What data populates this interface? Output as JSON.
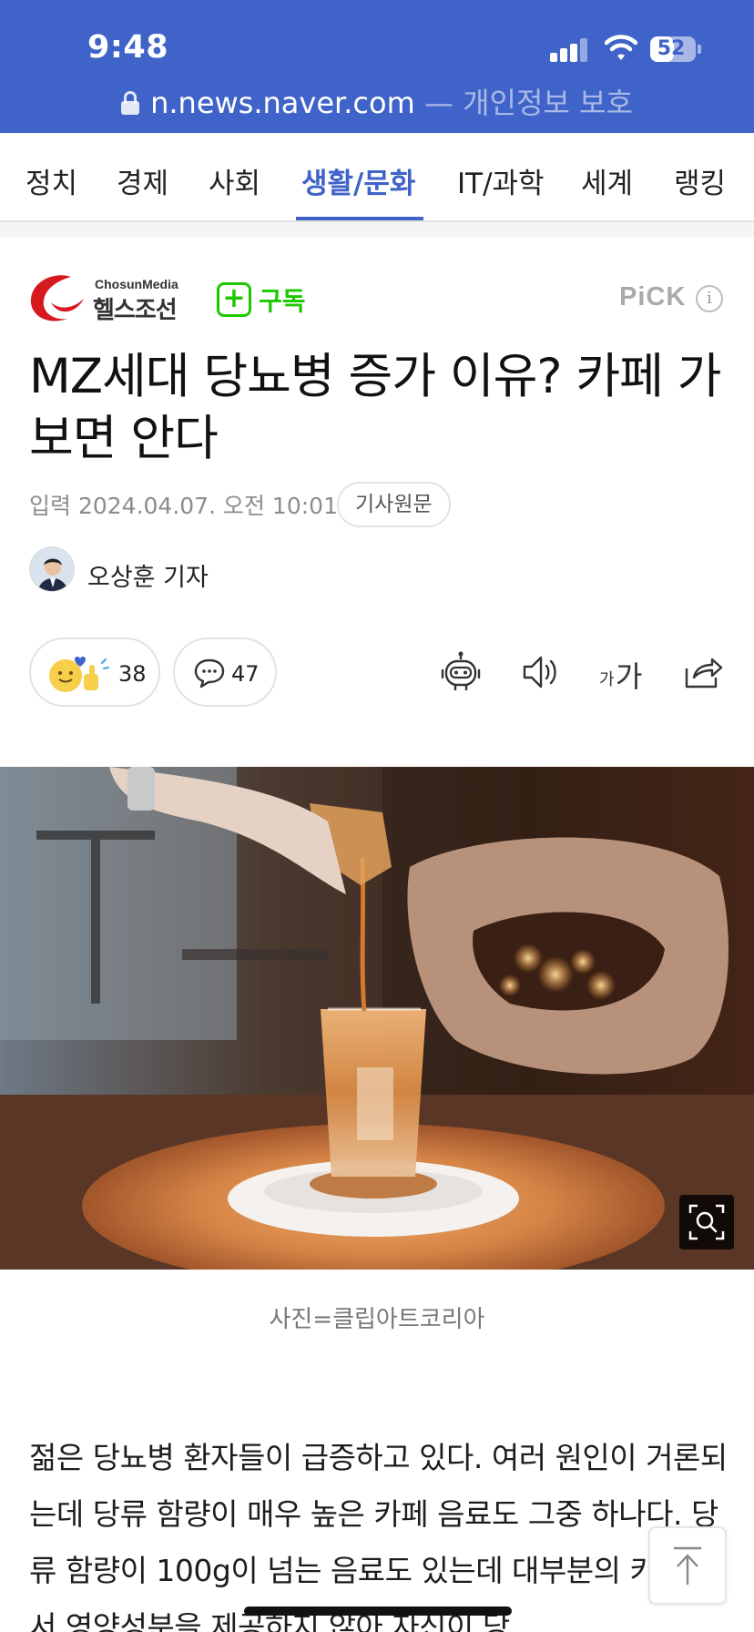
{
  "status": {
    "time": "9:48",
    "battery": "52",
    "battery_level": 0.52
  },
  "browser": {
    "url": "n.news.naver.com",
    "separator": " — ",
    "privacy_label": "개인정보 보호"
  },
  "tabs": [
    "정치",
    "경제",
    "사회",
    "생활/문화",
    "IT/과학",
    "세계",
    "랭킹"
  ],
  "active_tab": "생활/문화",
  "publisher": {
    "logo_en": "ChosunMedia",
    "logo_ko": "헬스조선",
    "subscribe_label": "구독",
    "pick_label": "PiCK",
    "info_glyph": "i"
  },
  "article": {
    "headline": "MZ세대 당뇨병 증가 이유? 카페 가보면 안다",
    "dateline": "입력 2024.04.07. 오전 10:01",
    "original_button": "기사원문",
    "author": "오상훈 기자",
    "reaction_count": "38",
    "comment_count": "47",
    "font_size_label_small": "가",
    "font_size_label_large": "가",
    "photo_caption": "사진=클립아트코리아",
    "body": "젊은 당뇨병 환자들이 급증하고 있다. 여러 원인이 거론되는데 당류 함량이 매우 높은 카페 음료도 그중 하나다. 당류 함량이 100g이 넘는 음료도 있는데 대부분의 카페에서 영양성분을 제공하지 않아 자신이 당"
  },
  "colors": {
    "brand_blue": "#3f63c8",
    "naver_green": "#1ec800",
    "logo_red": "#d6191f"
  }
}
